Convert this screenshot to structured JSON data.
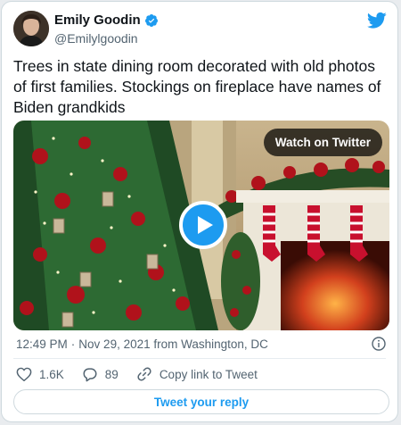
{
  "author": {
    "name": "Emily Goodin",
    "handle": "@Emilylgoodin",
    "verified": true
  },
  "tweet": {
    "text": "Trees in state dining room decorated with old photos of first families. Stockings on fireplace have names of Biden grandkids",
    "time": "12:49 PM",
    "separator": "·",
    "date_source": "Nov 29, 2021 from Washington, DC"
  },
  "media": {
    "watch_label": "Watch on Twitter"
  },
  "actions": {
    "likes": "1.6K",
    "replies": "89",
    "copy_link": "Copy link to Tweet"
  },
  "reply_button": "Tweet your reply",
  "colors": {
    "accent": "#1d9bf0",
    "text": "#0f1419",
    "muted": "#536471",
    "like": "#f91880"
  },
  "icons": [
    "verified-badge-icon",
    "twitter-bird-icon",
    "play-icon",
    "info-icon",
    "heart-icon",
    "reply-bubble-icon",
    "link-icon"
  ]
}
